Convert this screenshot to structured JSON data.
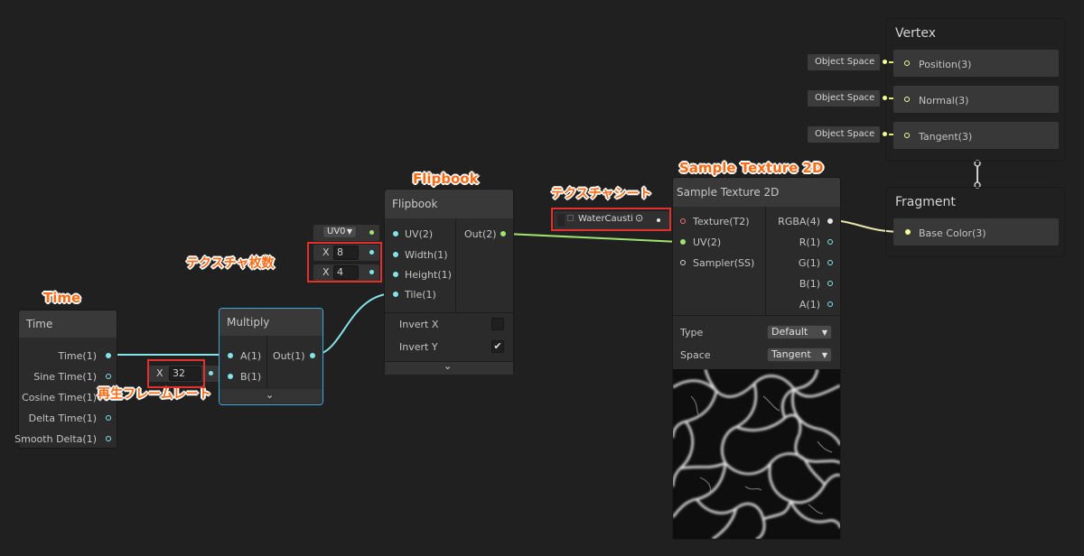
{
  "annotations": {
    "time": "Time",
    "flipbook": "Flipbook",
    "sample_texture": "Sample Texture 2D",
    "texture_sheet": "テクスチャシート",
    "texture_count": "テクスチャ枚数",
    "frame_rate": "再生フレームレート"
  },
  "time_node": {
    "title": "Time",
    "outputs": [
      "Time(1)",
      "Sine Time(1)",
      "Cosine Time(1)",
      "Delta Time(1)",
      "Smooth Delta(1)"
    ]
  },
  "multiply_node": {
    "title": "Multiply",
    "inputs": [
      "A(1)",
      "B(1)"
    ],
    "output": "Out(1)",
    "b_axis": "X",
    "b_value": "32"
  },
  "flipbook_node": {
    "title": "Flipbook",
    "inputs": [
      "UV(2)",
      "Width(1)",
      "Height(1)",
      "Tile(1)"
    ],
    "output": "Out(2)",
    "uv_dropdown": "UV0",
    "width_axis": "X",
    "width_value": "8",
    "height_axis": "X",
    "height_value": "4",
    "toggles": [
      {
        "label": "Invert X",
        "checked": false
      },
      {
        "label": "Invert Y",
        "checked": true
      }
    ]
  },
  "sample_node": {
    "title": "Sample Texture 2D",
    "inputs": [
      "Texture(T2)",
      "UV(2)",
      "Sampler(SS)"
    ],
    "outputs": [
      "RGBA(4)",
      "R(1)",
      "G(1)",
      "B(1)",
      "A(1)"
    ],
    "texture_field": "WaterCausti",
    "type_label": "Type",
    "type_value": "Default",
    "space_label": "Space",
    "space_value": "Tangent"
  },
  "vertex_block": {
    "title": "Vertex",
    "slots": [
      {
        "input": "Object Space",
        "label": "Position(3)"
      },
      {
        "input": "Object Space",
        "label": "Normal(3)"
      },
      {
        "input": "Object Space",
        "label": "Tangent(3)"
      }
    ]
  },
  "fragment_block": {
    "title": "Fragment",
    "slots": [
      {
        "label": "Base Color(3)"
      }
    ]
  },
  "colors": {
    "background": "#202020",
    "float_port": "#84e4e7",
    "vector2_port": "#9fe370",
    "vector3_port": "#f6ff9a",
    "texture_port": "#ee7373",
    "selection": "#44a8e0",
    "annotation": "#ff6a12",
    "annotation_box": "#e3302a"
  }
}
